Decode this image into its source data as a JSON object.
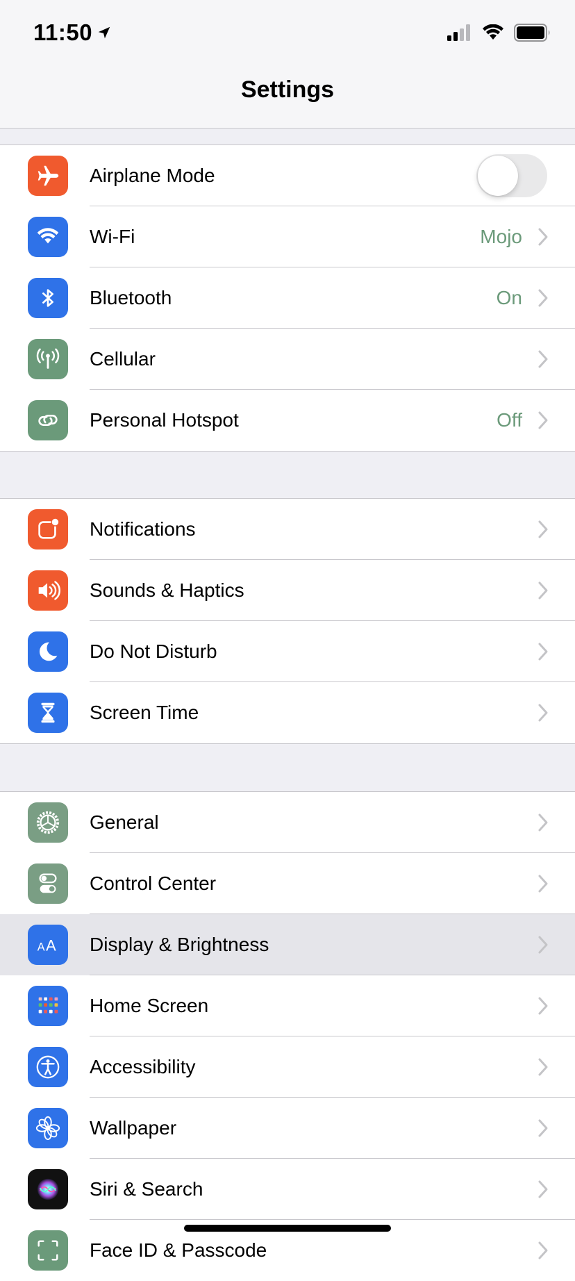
{
  "status_bar": {
    "time": "11:50"
  },
  "nav": {
    "title": "Settings"
  },
  "groups": [
    {
      "rows": [
        {
          "label": "Airplane Mode",
          "icon": "airplane-icon",
          "color": "#f05a2e",
          "toggle": false
        },
        {
          "label": "Wi-Fi",
          "icon": "wifi-icon",
          "color": "#2f72e8",
          "value": "Mojo"
        },
        {
          "label": "Bluetooth",
          "icon": "bluetooth-icon",
          "color": "#2f72e8",
          "value": "On"
        },
        {
          "label": "Cellular",
          "icon": "cellular-antenna-icon",
          "color": "#6b9a7a"
        },
        {
          "label": "Personal Hotspot",
          "icon": "hotspot-link-icon",
          "color": "#6b9a7a",
          "value": "Off"
        }
      ]
    },
    {
      "rows": [
        {
          "label": "Notifications",
          "icon": "notifications-icon",
          "color": "#f05a2e"
        },
        {
          "label": "Sounds & Haptics",
          "icon": "speaker-icon",
          "color": "#f05a2e"
        },
        {
          "label": "Do Not Disturb",
          "icon": "moon-icon",
          "color": "#2f72e8"
        },
        {
          "label": "Screen Time",
          "icon": "hourglass-icon",
          "color": "#2f72e8"
        }
      ]
    },
    {
      "rows": [
        {
          "label": "General",
          "icon": "gear-icon",
          "color": "#7a9e84"
        },
        {
          "label": "Control Center",
          "icon": "switches-icon",
          "color": "#7a9e84"
        },
        {
          "label": "Display & Brightness",
          "icon": "text-size-icon",
          "color": "#2f72e8",
          "selected": true
        },
        {
          "label": "Home Screen",
          "icon": "app-grid-icon",
          "color": "#2f72e8"
        },
        {
          "label": "Accessibility",
          "icon": "accessibility-icon",
          "color": "#2f72e8"
        },
        {
          "label": "Wallpaper",
          "icon": "flower-icon",
          "color": "#2f72e8"
        },
        {
          "label": "Siri & Search",
          "icon": "siri-icon",
          "color": "#111111"
        },
        {
          "label": "Face ID & Passcode",
          "icon": "face-id-icon",
          "color": "#6b9a7a"
        }
      ]
    }
  ]
}
